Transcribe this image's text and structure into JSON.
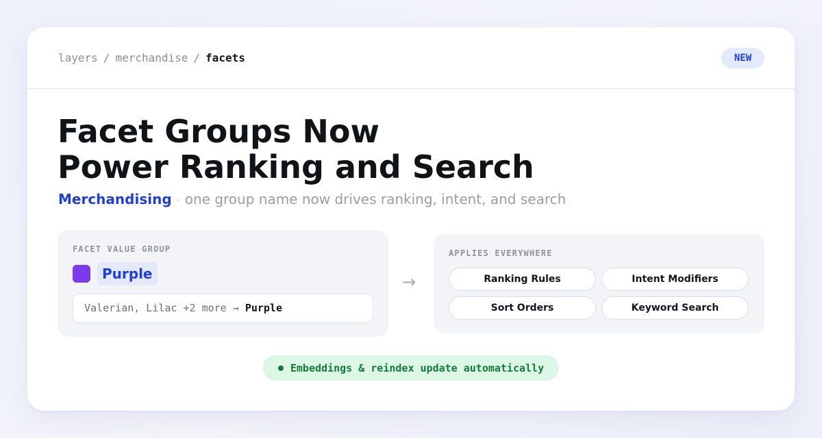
{
  "breadcrumb": {
    "items": [
      "layers",
      "merchandise",
      "facets"
    ],
    "separator": "/"
  },
  "badge": {
    "label": "NEW"
  },
  "headline": {
    "line1": "Facet Groups Now",
    "line2": "Power Ranking and Search"
  },
  "subline": {
    "category": "Merchandising",
    "separator": "·",
    "description": "one group name now drives ranking, intent, and search"
  },
  "facet_group": {
    "label": "FACET VALUE GROUP",
    "name": "Purple",
    "swatch_color": "#7c3aed",
    "mapping_sources": "Valerian, Lilac +2 more",
    "mapping_arrow": "→",
    "mapping_target": "Purple"
  },
  "flow_arrow": "→",
  "applies": {
    "label": "APPLIES EVERYWHERE",
    "items": [
      "Ranking Rules",
      "Intent Modifiers",
      "Sort Orders",
      "Keyword Search"
    ]
  },
  "status": {
    "text": "Embeddings & reindex update automatically",
    "color": "#137a3a"
  },
  "colors": {
    "accent": "#1f3fd6",
    "badge_bg": "#e4eafd",
    "status_bg": "#dcf7e6"
  }
}
